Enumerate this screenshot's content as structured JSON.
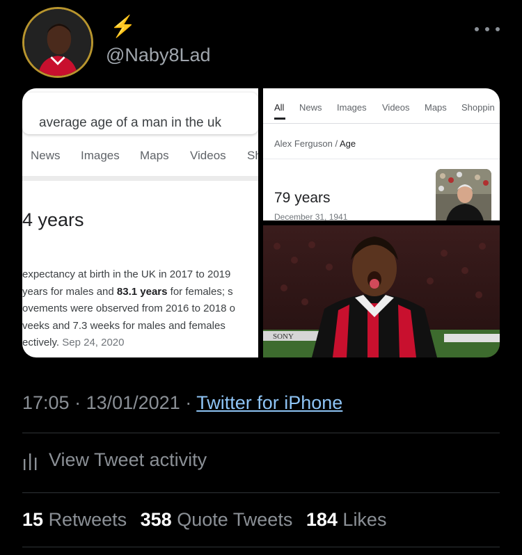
{
  "tweet": {
    "bolt": "⚡",
    "handle": "@Naby8Lad",
    "more_icon": "more-horizontal-icon"
  },
  "media": {
    "left_search": {
      "query": "average age of a man in the uk",
      "tabs": [
        "News",
        "Images",
        "Maps",
        "Videos",
        "Sh"
      ],
      "answer": "4 years",
      "desc_lines": [
        "expectancy at birth in the UK in 2017 to 2019",
        "years for males and",
        "83.1 years",
        "for females; s",
        "ovements were observed from 2016 to 2018 o",
        "veeks and 7.3 weeks for males and females",
        "ectively.",
        "Sep 24, 2020"
      ]
    },
    "right_search": {
      "tabs": [
        "All",
        "News",
        "Images",
        "Videos",
        "Maps",
        "Shoppin"
      ],
      "breadcrumb_name": "Alex Ferguson",
      "breadcrumb_sep": "/",
      "breadcrumb_attr": "Age",
      "answer": "79 years",
      "born": "December 31, 1941"
    },
    "gif": {
      "board_text": "SONY"
    }
  },
  "meta": {
    "time": "17:05",
    "sep1": " · ",
    "date": "13/01/2021",
    "sep2": " · ",
    "source": "Twitter for iPhone"
  },
  "activity": {
    "label": "View Tweet activity",
    "icon": "analytics-icon"
  },
  "stats": {
    "retweets_count": "15",
    "retweets_label": "Retweets",
    "quotes_count": "358",
    "quotes_label": "Quote Tweets",
    "likes_count": "184",
    "likes_label": "Likes"
  },
  "colors": {
    "background": "#000000",
    "secondary_text": "#8b9096",
    "link": "#8ec4f5",
    "avatar_ring": "#b8952e"
  }
}
